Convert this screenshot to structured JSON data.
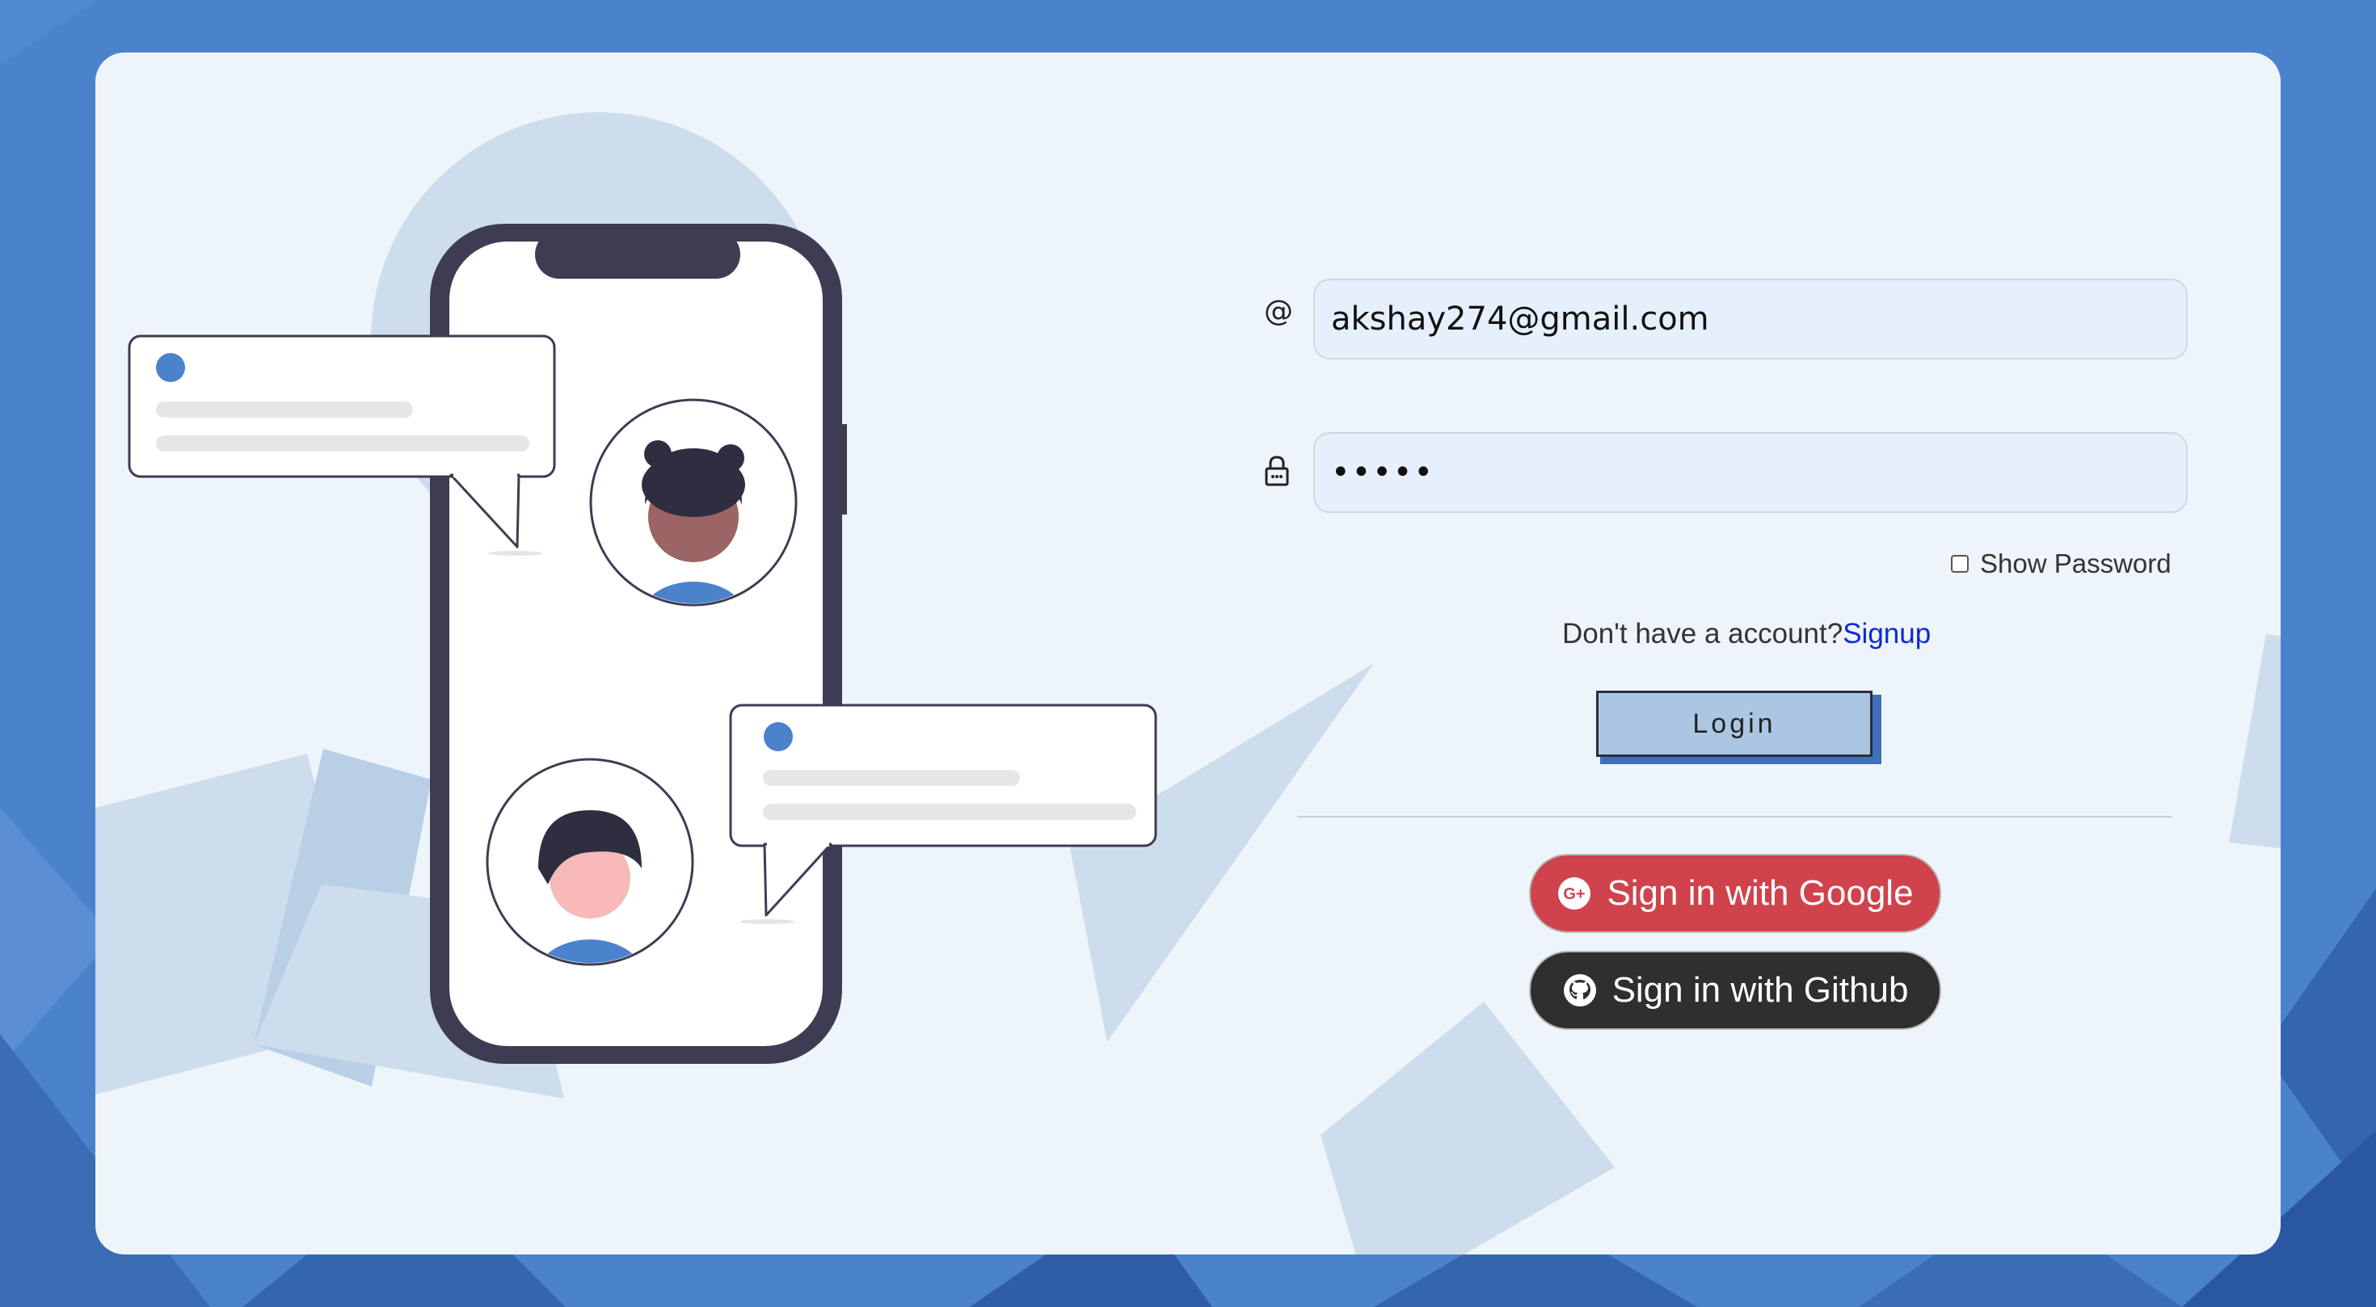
{
  "colors": {
    "background": "#4a82cc",
    "card": "#eef5fa",
    "accent": "#4a82cc",
    "google_button": "#d0434c",
    "github_button": "#2f2f2f",
    "signup_link": "#1028d8",
    "login_button": "#aac6e2"
  },
  "form": {
    "email_icon": "@",
    "email_value": "akshay274@gmail.com",
    "password_icon": "lock-icon",
    "password_value": "•••••",
    "show_password_label": "Show Password",
    "signup_prompt": "Don't have a account?",
    "signup_link": "Signup",
    "login_label": "Login",
    "google_label": "Sign in with Google",
    "google_icon": "google-plus-icon",
    "github_label": "Sign in with Github",
    "github_icon": "github-icon"
  }
}
